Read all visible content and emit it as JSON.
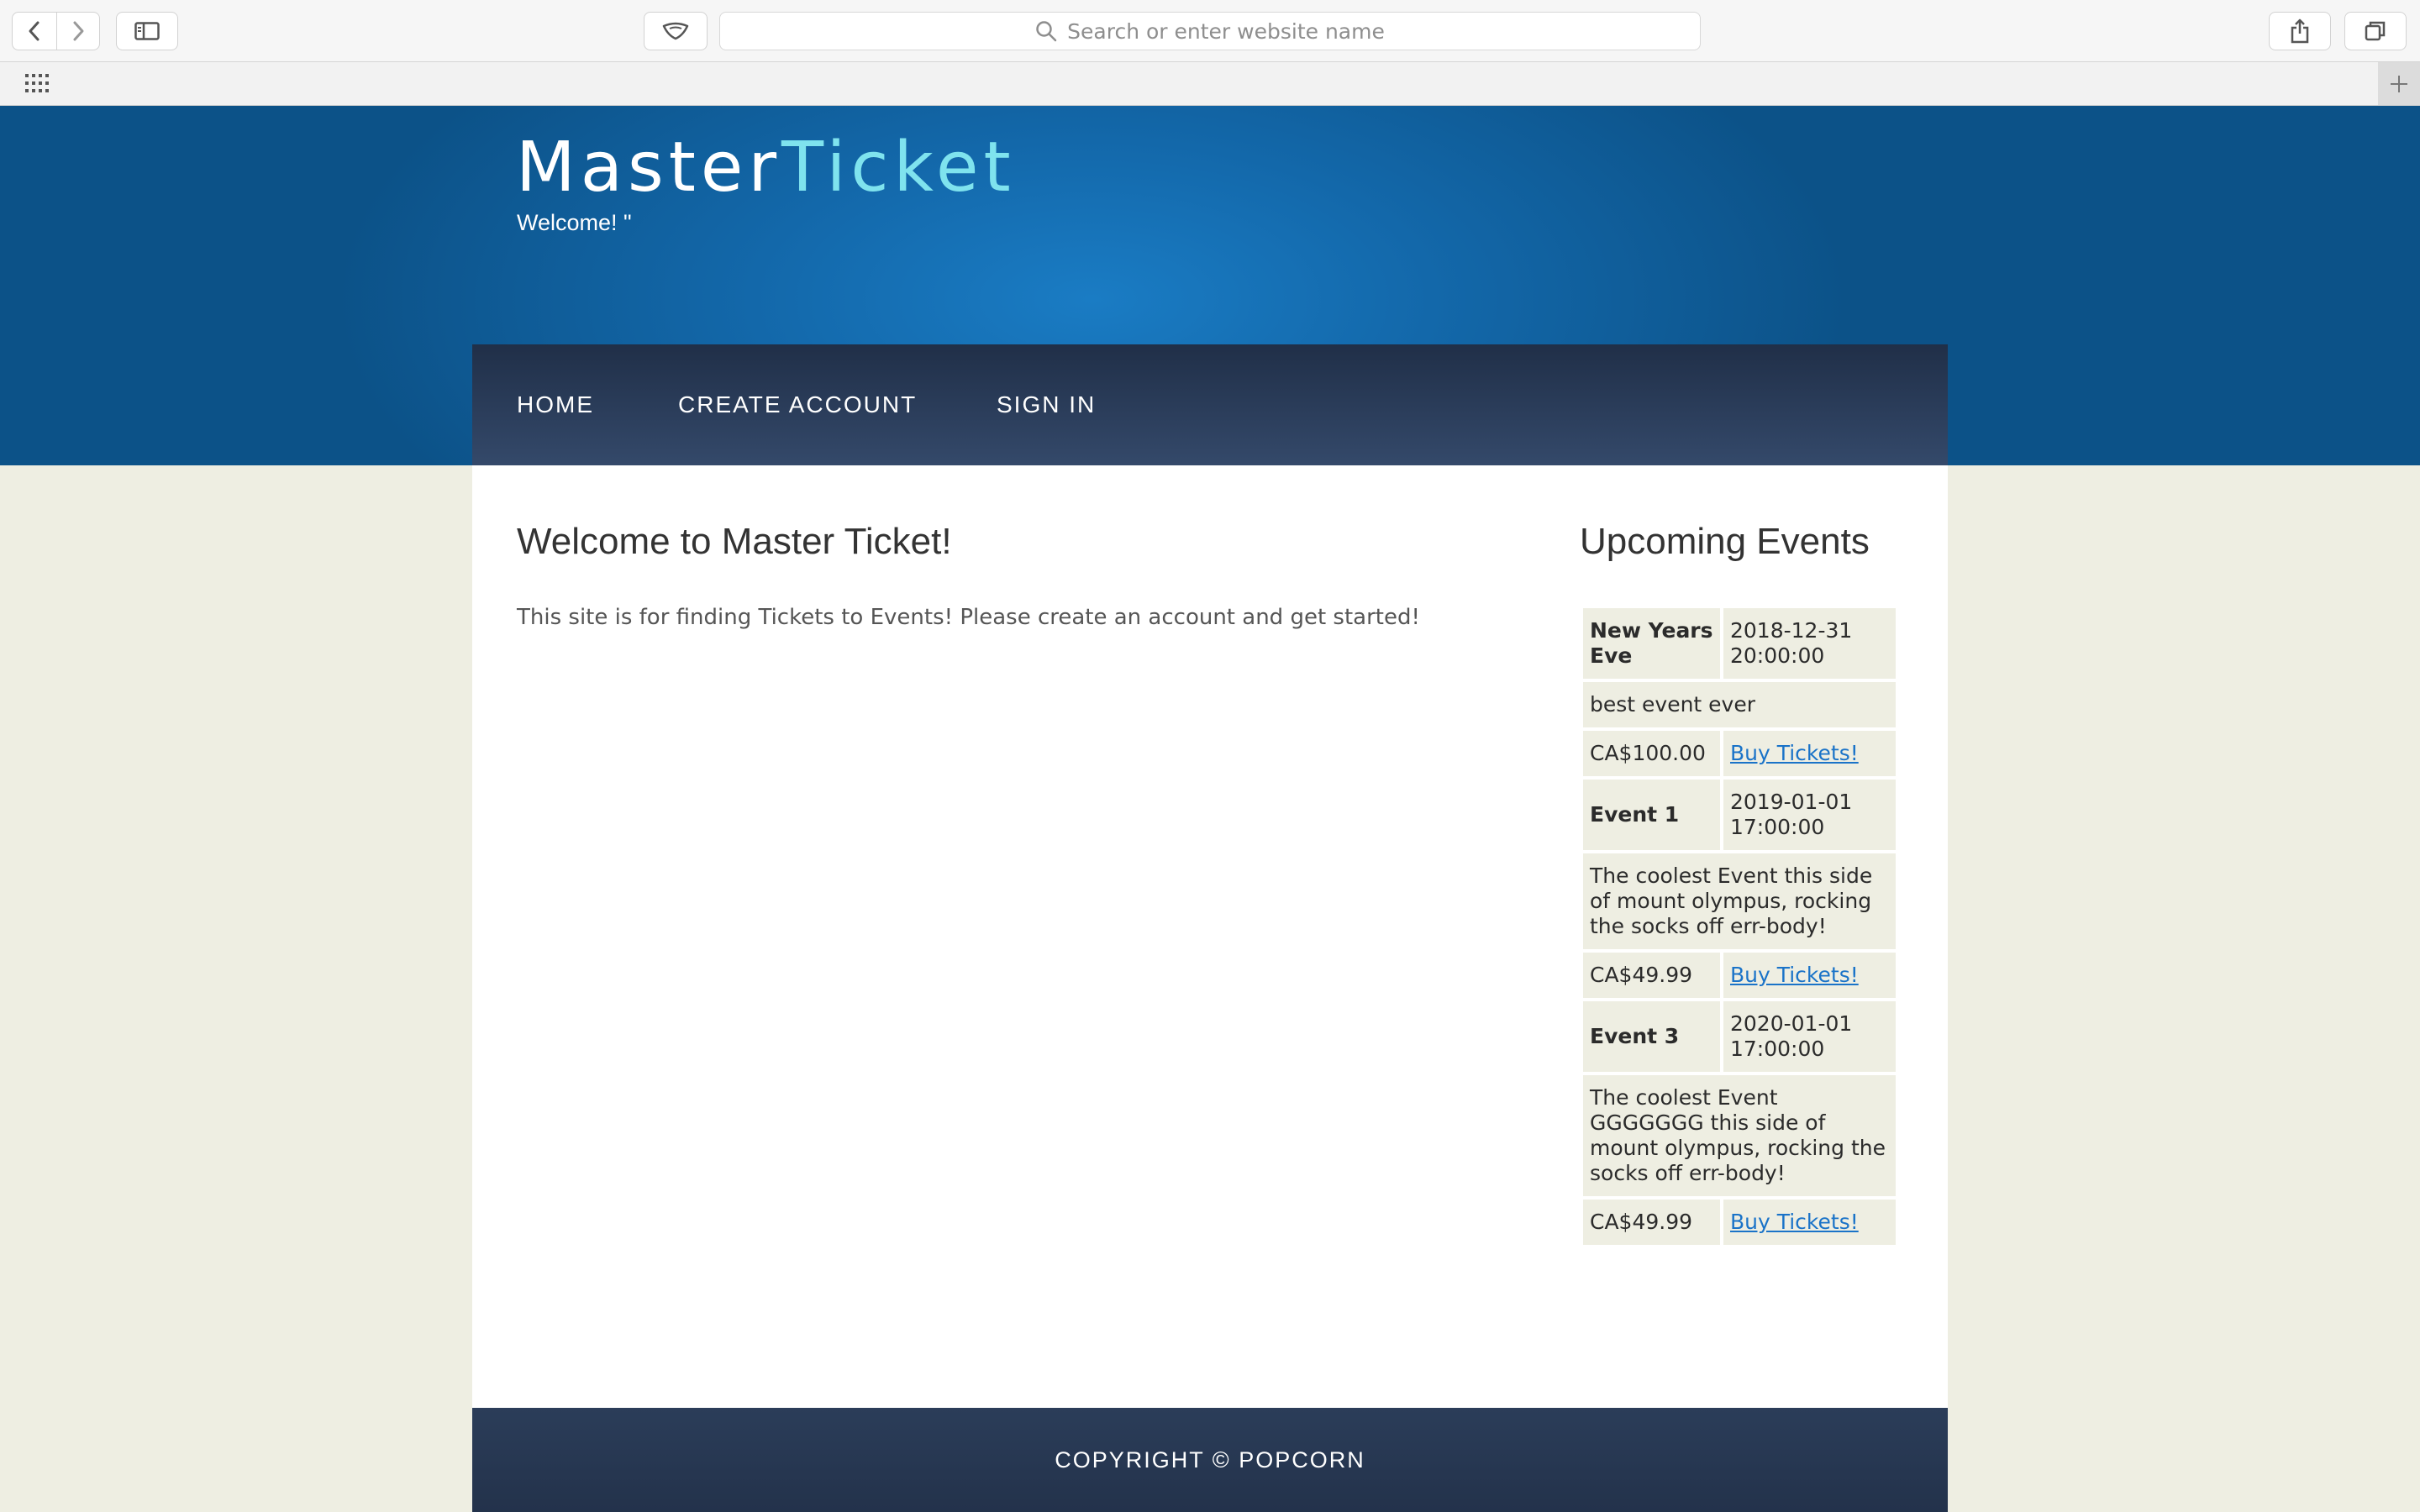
{
  "browser": {
    "address_placeholder": "Search or enter website name"
  },
  "site": {
    "logo_part1": "Master",
    "logo_part2": "Ticket",
    "welcome": "Welcome! \"",
    "nav": [
      "HOME",
      "CREATE ACCOUNT",
      "SIGN IN"
    ]
  },
  "main": {
    "title": "Welcome to Master Ticket!",
    "text": "This site is for finding Tickets to Events! Please create an account and get started!"
  },
  "sidebar": {
    "title": "Upcoming Events",
    "events": [
      {
        "name": "New Years Eve",
        "date": "2018-12-31 20:00:00",
        "description": "best event ever",
        "price": "CA$100.00",
        "link": "Buy Tickets!"
      },
      {
        "name": "Event 1",
        "date": "2019-01-01 17:00:00",
        "description": "The coolest Event this side of mount olympus, rocking the socks off err-body!",
        "price": "CA$49.99",
        "link": "Buy Tickets!"
      },
      {
        "name": "Event 3",
        "date": "2020-01-01 17:00:00",
        "description": "The coolest Event GGGGGGG this side of mount olympus, rocking the socks off err-body!",
        "price": "CA$49.99",
        "link": "Buy Tickets!"
      }
    ]
  },
  "footer": {
    "text": "COPYRIGHT © POPCORN"
  }
}
